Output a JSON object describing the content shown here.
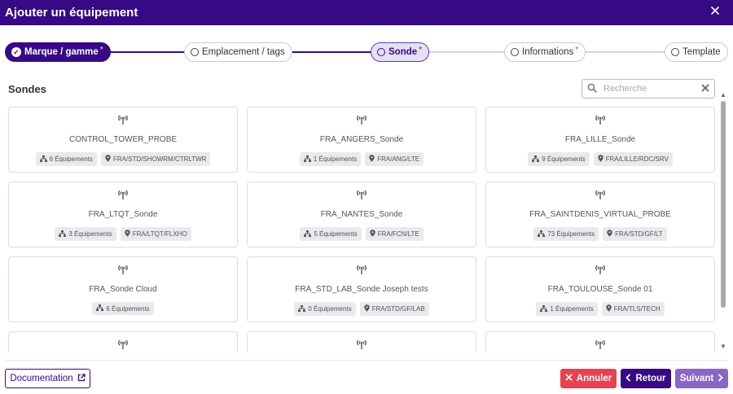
{
  "header": {
    "title": "Ajouter un équipement",
    "close_glyph": "✕"
  },
  "stepper": {
    "steps": [
      {
        "label": "Marque / gamme",
        "required": "*"
      },
      {
        "label": "Emplacement / tags",
        "required": ""
      },
      {
        "label": "Sonde",
        "required": "*"
      },
      {
        "label": "Informations",
        "required": "*"
      },
      {
        "label": "Template",
        "required": ""
      }
    ]
  },
  "section": {
    "title": "Sondes"
  },
  "search": {
    "placeholder": "Recherche",
    "value": ""
  },
  "icons": {
    "probe": "antenna-icon",
    "equipment": "sitemap-icon",
    "location": "map-pin-icon",
    "search": "search-icon",
    "clear": "close-icon"
  },
  "cards": [
    {
      "name": "CONTROL_TOWER_PROBE",
      "equipments": "6 Équipements",
      "location": "FRA/STD/SHOWRM/CTRLTWR"
    },
    {
      "name": "FRA_ANGERS_Sonde",
      "equipments": "1 Équipements",
      "location": "FRA/ANG/LTE"
    },
    {
      "name": "FRA_LILLE_Sonde",
      "equipments": "9 Équipements",
      "location": "FRA/LILLE/RDC/SRV"
    },
    {
      "name": "FRA_LTQT_Sonde",
      "equipments": "3 Équipements",
      "location": "FRA/LTQT/FLXHO"
    },
    {
      "name": "FRA_NANTES_Sonde",
      "equipments": "5 Équipements",
      "location": "FRA/FCN/LTE"
    },
    {
      "name": "FRA_SAINTDENIS_VIRTUAL_PROBE",
      "equipments": "73 Équipements",
      "location": "FRA/STD/GF/LT"
    },
    {
      "name": "FRA_Sonde Cloud",
      "equipments": "6 Équipements",
      "location": ""
    },
    {
      "name": "FRA_STD_LAB_Sonde Joseph tests",
      "equipments": "0 Équipements",
      "location": "FRA/STD/GF/LAB"
    },
    {
      "name": "FRA_TOULOUSE_Sonde 01",
      "equipments": "1 Équipements",
      "location": "FRA/TLS/TECH"
    },
    {
      "name": "",
      "equipments": "",
      "location": ""
    },
    {
      "name": "",
      "equipments": "",
      "location": ""
    },
    {
      "name": "",
      "equipments": "",
      "location": ""
    }
  ],
  "footer": {
    "documentation": "Documentation",
    "cancel": "Annuler",
    "back": "Retour",
    "next": "Suivant"
  },
  "colors": {
    "primary": "#360a85",
    "danger": "#e8414f",
    "secondary": "#8a66c9"
  }
}
